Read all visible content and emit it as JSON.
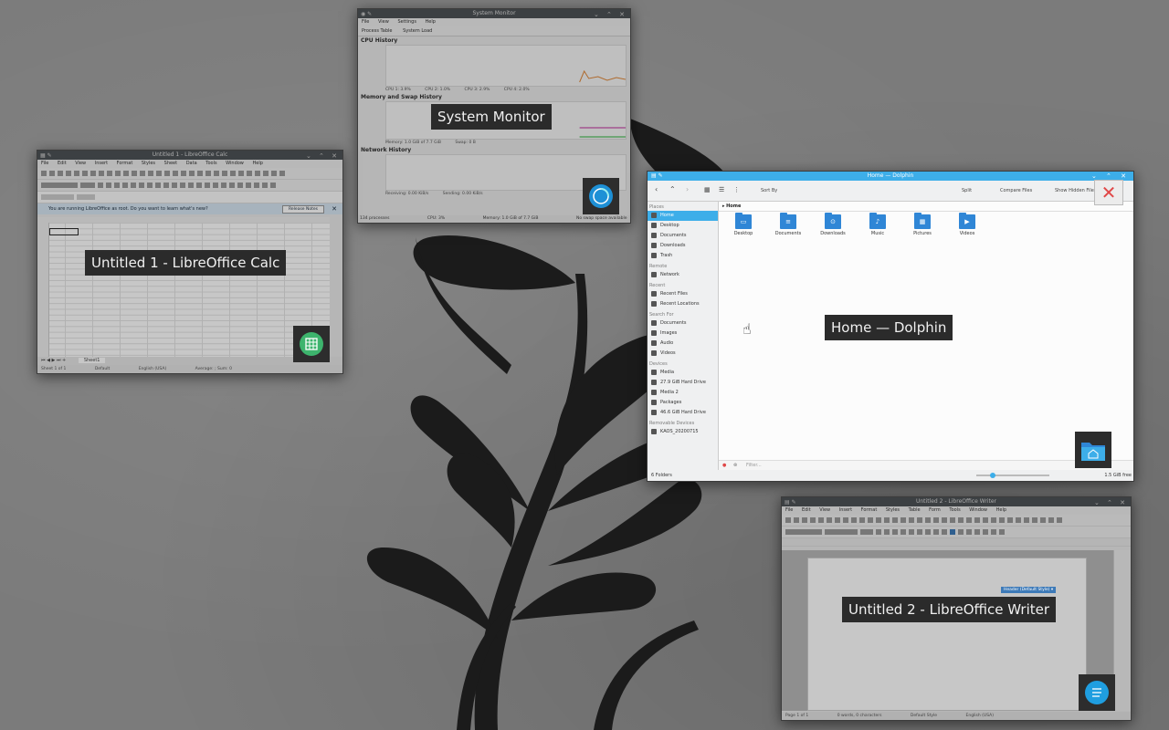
{
  "desktop": {
    "wallpaper": "dark plant silhouette on grey wall"
  },
  "windows": {
    "system_monitor": {
      "title": "System Monitor",
      "label": "System Monitor",
      "menu": [
        "File",
        "View",
        "Settings",
        "Help"
      ],
      "tabs": [
        "Process Table",
        "System Load"
      ],
      "sections": [
        "CPU History",
        "Memory and Swap History",
        "Network History"
      ],
      "cpu_legend": [
        "CPU 1: 3.9%",
        "CPU 2: 1.0%",
        "CPU 3: 2.9%",
        "CPU 4: 2.0%"
      ],
      "mem_legend": [
        "Memory: 1.0 GiB of 7.7 GiB",
        "Swap: 0 B"
      ],
      "net_legend": [
        "Receiving: 0.00 KiB/s",
        "Sending: 0.00 KiB/s"
      ],
      "status": [
        "134 processes",
        "CPU: 3%",
        "Memory: 1.0 GiB of 7.7 GiB",
        "No swap space available"
      ],
      "icon": "system-monitor-icon"
    },
    "calc": {
      "title": "Untitled 1 - LibreOffice Calc",
      "label": "Untitled 1 - LibreOffice Calc",
      "menu": [
        "File",
        "Edit",
        "View",
        "Insert",
        "Format",
        "Styles",
        "Sheet",
        "Data",
        "Tools",
        "Window",
        "Help"
      ],
      "infobar_text": "You are running LibreOffice as root. Do you want to learn what's new?",
      "infobar_button": "Release Notes",
      "sheet_tab": "Sheet1",
      "status": [
        "Sheet 1 of 1",
        "Default",
        "English (USA)",
        "Average: ; Sum: 0"
      ],
      "icon": "spreadsheet-icon"
    },
    "dolphin": {
      "title": "Home — Dolphin",
      "label": "Home — Dolphin",
      "toolbar": {
        "sort": "Sort By",
        "split": "Split",
        "compare": "Compare Files",
        "hidden": "Show Hidden Files"
      },
      "breadcrumb": "Home",
      "places_header": "Places",
      "places": [
        "Home",
        "Desktop",
        "Documents",
        "Downloads",
        "Trash"
      ],
      "remote_header": "Remote",
      "remote": [
        "Network"
      ],
      "recent_header": "Recent",
      "recent": [
        "Recent Files",
        "Recent Locations"
      ],
      "search_header": "Search For",
      "search": [
        "Documents",
        "Images",
        "Audio",
        "Videos"
      ],
      "devices_header": "Devices",
      "devices": [
        "Media",
        "27.9 GiB Hard Drive",
        "Media 2",
        "Packages",
        "46.6 GiB Hard Drive"
      ],
      "removable_header": "Removable Devices",
      "removable": [
        "KAOS_20200715"
      ],
      "folders": [
        {
          "name": "Desktop",
          "glyph": "▭"
        },
        {
          "name": "Documents",
          "glyph": "≡"
        },
        {
          "name": "Downloads",
          "glyph": "⊙"
        },
        {
          "name": "Music",
          "glyph": "♪"
        },
        {
          "name": "Pictures",
          "glyph": "▦"
        },
        {
          "name": "Videos",
          "glyph": "▶"
        }
      ],
      "filter_placeholder": "Filter...",
      "status_left": "6 Folders",
      "status_right": "1.5 GiB free",
      "icon": "folder-icon"
    },
    "writer": {
      "title": "Untitled 2 - LibreOffice Writer",
      "label": "Untitled 2 - LibreOffice Writer",
      "menu": [
        "File",
        "Edit",
        "View",
        "Insert",
        "Format",
        "Styles",
        "Table",
        "Form",
        "Tools",
        "Window",
        "Help"
      ],
      "header_tag": "Header (Default Style) ▾",
      "status": [
        "Page 1 of 1",
        "0 words, 0 characters",
        "Default Style",
        "English (USA)"
      ],
      "icon": "document-icon"
    }
  },
  "overlay": {
    "close_glyph": "✕"
  },
  "colors": {
    "accent": "#3daee9",
    "close_red": "#e04848",
    "label_bg": "#2b2b2b"
  }
}
